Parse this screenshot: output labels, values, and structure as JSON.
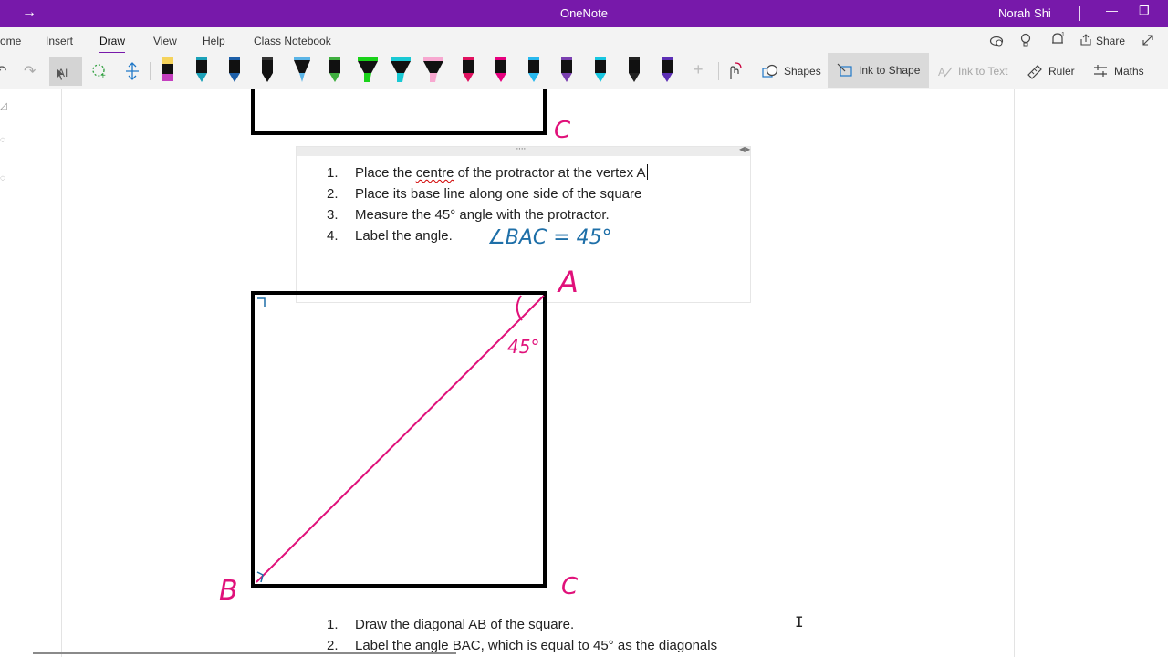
{
  "titlebar": {
    "back_icon": "arrow-right-icon",
    "app_title": "OneNote",
    "user_name": "Norah Shi",
    "minimize_icon": "minimize-icon",
    "restore_icon": "restore-icon"
  },
  "tabs": {
    "home": "ome",
    "insert": "Insert",
    "draw": "Draw",
    "view": "View",
    "help": "Help",
    "class_notebook": "Class Notebook"
  },
  "top_right": {
    "share_label": "Share"
  },
  "toolbar": {
    "shapes_label": "Shapes",
    "ink_to_shape_label": "Ink to Shape",
    "ink_to_text_label": "Ink to Text",
    "ruler_label": "Ruler",
    "maths_label": "Maths",
    "pens": [
      {
        "name": "highlighter-yellow-pink",
        "color": "#c43fbf"
      },
      {
        "name": "pen-teal",
        "color": "#1ba1b8"
      },
      {
        "name": "pen-blue",
        "color": "#1d5fa8"
      },
      {
        "name": "pen-black",
        "color": "#111111"
      },
      {
        "name": "pen-lightblue",
        "color": "#5ab4e6"
      },
      {
        "name": "pen-green",
        "color": "#3fae3f"
      },
      {
        "name": "highlighter-green",
        "color": "#19d219"
      },
      {
        "name": "highlighter-cyan",
        "color": "#19c9d4"
      },
      {
        "name": "highlighter-pink",
        "color": "#f7a8d0"
      },
      {
        "name": "pen-crimson",
        "color": "#e0115f"
      },
      {
        "name": "pen-magenta",
        "color": "#e6007e"
      },
      {
        "name": "pen-sky",
        "color": "#28b8ee"
      },
      {
        "name": "pen-purple",
        "color": "#7a3fb0"
      },
      {
        "name": "pen-aqua",
        "color": "#18c6e0"
      },
      {
        "name": "pen-black-2",
        "color": "#222222"
      },
      {
        "name": "pen-violet",
        "color": "#5c2fb5"
      }
    ]
  },
  "steps_top": [
    {
      "num": "1.",
      "pre": "Place the ",
      "squiggle": "centre",
      "post": " of the protractor at the vertex A"
    },
    {
      "num": "2.",
      "text": "Place its base line along one side of the square"
    },
    {
      "num": "3.",
      "text": "Measure the 45° angle with the protractor."
    },
    {
      "num": "4.",
      "text": "Label the angle."
    }
  ],
  "steps_bottom": [
    {
      "num": "1.",
      "text": "Draw the diagonal AB of the square."
    },
    {
      "num": "2.",
      "text": "Label the angle BAC, which is equal to 45° as the diagonals"
    }
  ],
  "ink": {
    "angle_eq": "∠BAC = 45°",
    "label_a": "A",
    "label_b": "B",
    "label_c_top": "C",
    "label_c_bottom": "C",
    "label_45": "45°",
    "colors": {
      "magenta": "#e0117a",
      "blue": "#1e6fa8",
      "black": "#000000"
    }
  }
}
